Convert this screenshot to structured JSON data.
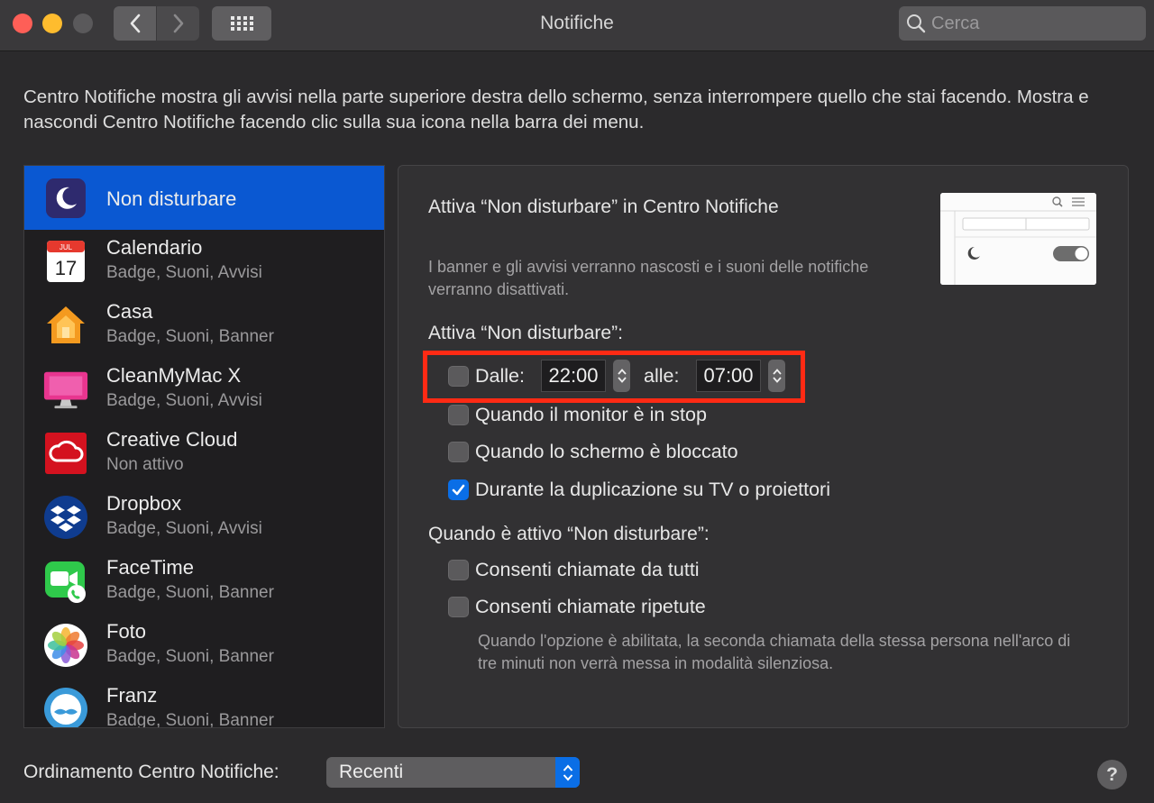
{
  "window": {
    "title": "Notifiche"
  },
  "search": {
    "placeholder": "Cerca"
  },
  "description": "Centro Notifiche mostra gli avvisi nella parte superiore destra dello schermo, senza interrompere quello che stai facendo. Mostra e nascondi Centro Notifiche facendo clic sulla sua icona nella barra dei menu.",
  "apps": [
    {
      "name": "Non disturbare",
      "sub": "",
      "icon": "moon-icon",
      "selected": true
    },
    {
      "name": "Calendario",
      "sub": "Badge, Suoni, Avvisi",
      "icon": "calendar-icon",
      "cal_month": "JUL",
      "cal_day": "17"
    },
    {
      "name": "Casa",
      "sub": "Badge, Suoni, Banner",
      "icon": "home-icon"
    },
    {
      "name": "CleanMyMac X",
      "sub": "Badge, Suoni, Avvisi",
      "icon": "cleanmymac-icon"
    },
    {
      "name": "Creative Cloud",
      "sub": "Non attivo",
      "icon": "creative-cloud-icon"
    },
    {
      "name": "Dropbox",
      "sub": "Badge, Suoni, Avvisi",
      "icon": "dropbox-icon"
    },
    {
      "name": "FaceTime",
      "sub": "Badge, Suoni, Banner",
      "icon": "facetime-icon"
    },
    {
      "name": "Foto",
      "sub": "Badge, Suoni, Banner",
      "icon": "photos-icon"
    },
    {
      "name": "Franz",
      "sub": "Badge, Suoni, Banner",
      "icon": "franz-icon"
    }
  ],
  "dnd": {
    "title": "Attiva “Non disturbare” in Centro Notifiche",
    "info": "I banner e gli avvisi verranno nascosti e i suoni delle notifiche verranno disattivati.",
    "activate_heading": "Attiva “Non disturbare”:",
    "from_label": "Dalle:",
    "from_time": "22:00",
    "to_label": "alle:",
    "to_time": "07:00",
    "schedule_checked": false,
    "options": [
      {
        "label": "Quando il monitor è in stop",
        "checked": false
      },
      {
        "label": "Quando lo schermo è bloccato",
        "checked": false
      },
      {
        "label": "Durante la duplicazione su TV o proiettori",
        "checked": true
      }
    ],
    "when_active_heading": "Quando è attivo “Non disturbare”:",
    "call_options": [
      {
        "label": "Consenti chiamate da tutti",
        "checked": false
      },
      {
        "label": "Consenti chiamate ripetute",
        "checked": false
      }
    ],
    "repeat_note": "Quando l'opzione è abilitata, la seconda chiamata della stessa persona nell'arco di tre minuti non verrà messa in modalità silenziosa."
  },
  "sort": {
    "label": "Ordinamento Centro Notifiche:",
    "value": "Recenti"
  },
  "help": {
    "label": "?"
  },
  "colors": {
    "accent": "#0a58d2",
    "highlight": "#ff2a14",
    "checkbox_checked": "#0a6ee6"
  }
}
